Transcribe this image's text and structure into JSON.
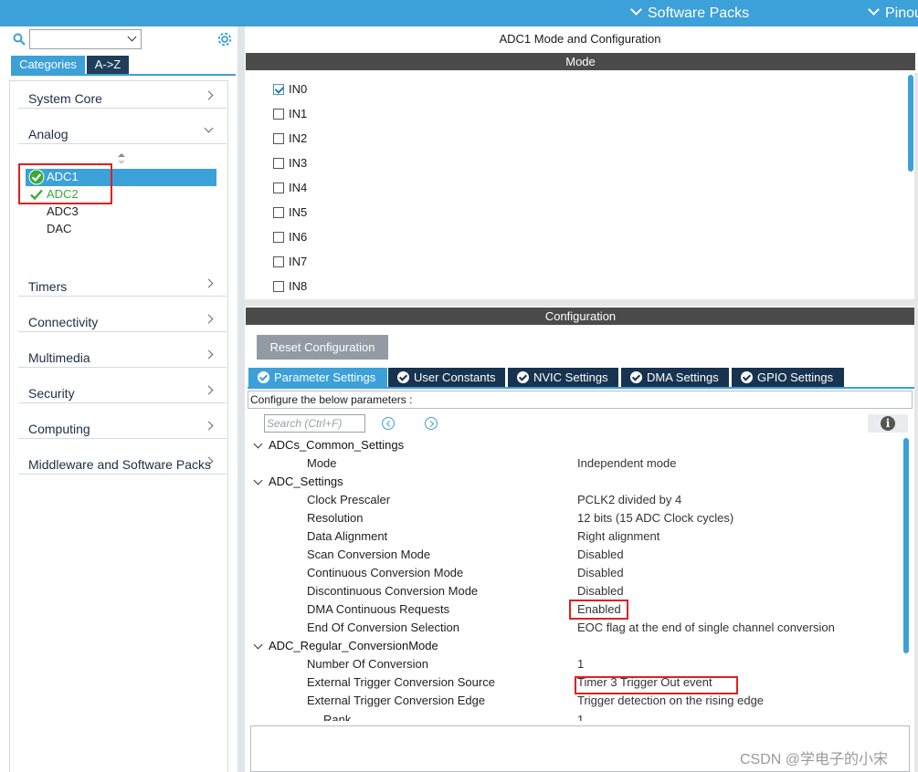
{
  "topbar": {
    "software_packs": "Software Packs",
    "pinout": "Pinout"
  },
  "sidebar": {
    "search_value": "",
    "tabs": {
      "categories": "Categories",
      "az": "A->Z"
    },
    "categories": [
      {
        "label": "System Core"
      },
      {
        "label": "Analog"
      },
      {
        "label": "Timers"
      },
      {
        "label": "Connectivity"
      },
      {
        "label": "Multimedia"
      },
      {
        "label": "Security"
      },
      {
        "label": "Computing"
      },
      {
        "label": "Middleware and Software Packs"
      }
    ],
    "analog_items": [
      "ADC1",
      "ADC2",
      "ADC3",
      "DAC"
    ],
    "selected": "ADC1"
  },
  "main": {
    "title": "ADC1 Mode and Configuration",
    "mode_header": "Mode",
    "inputs": [
      {
        "label": "IN0",
        "checked": true
      },
      {
        "label": "IN1",
        "checked": false
      },
      {
        "label": "IN2",
        "checked": false
      },
      {
        "label": "IN3",
        "checked": false
      },
      {
        "label": "IN4",
        "checked": false
      },
      {
        "label": "IN5",
        "checked": false
      },
      {
        "label": "IN6",
        "checked": false
      },
      {
        "label": "IN7",
        "checked": false
      },
      {
        "label": "IN8",
        "checked": false
      }
    ],
    "config_header": "Configuration",
    "reset_button": "Reset Configuration",
    "config_tabs": [
      "Parameter Settings",
      "User Constants",
      "NVIC Settings",
      "DMA Settings",
      "GPIO Settings"
    ],
    "active_tab": "Parameter Settings",
    "hint": "Configure the below parameters :",
    "search_placeholder": "Search (Ctrl+F)",
    "groups": [
      {
        "name": "ADCs_Common_Settings",
        "params": [
          {
            "name": "Mode",
            "value": "Independent mode"
          }
        ]
      },
      {
        "name": "ADC_Settings",
        "params": [
          {
            "name": "Clock Prescaler",
            "value": "PCLK2 divided by 4"
          },
          {
            "name": "Resolution",
            "value": "12 bits (15 ADC Clock cycles)"
          },
          {
            "name": "Data Alignment",
            "value": "Right alignment"
          },
          {
            "name": "Scan Conversion Mode",
            "value": "Disabled"
          },
          {
            "name": "Continuous Conversion Mode",
            "value": "Disabled"
          },
          {
            "name": "Discontinuous Conversion Mode",
            "value": "Disabled"
          },
          {
            "name": "DMA Continuous Requests",
            "value": "Enabled"
          },
          {
            "name": "End Of Conversion Selection",
            "value": "EOC flag at the end of single channel conversion"
          }
        ]
      },
      {
        "name": "ADC_Regular_ConversionMode",
        "params": [
          {
            "name": "Number Of Conversion",
            "value": "1"
          },
          {
            "name": "External Trigger Conversion Source",
            "value": "Timer 3 Trigger Out event"
          },
          {
            "name": "External Trigger Conversion Edge",
            "value": "Trigger detection on the rising edge"
          },
          {
            "name": "Rank",
            "value": "1"
          }
        ]
      }
    ]
  },
  "watermark": "CSDN @学电子的小宋",
  "colors": {
    "accent": "#3ca0d9",
    "dark_tab": "#17334f",
    "header_bar": "#4b4b4b",
    "highlight": "#e02020",
    "check_green": "#3aaa35"
  }
}
